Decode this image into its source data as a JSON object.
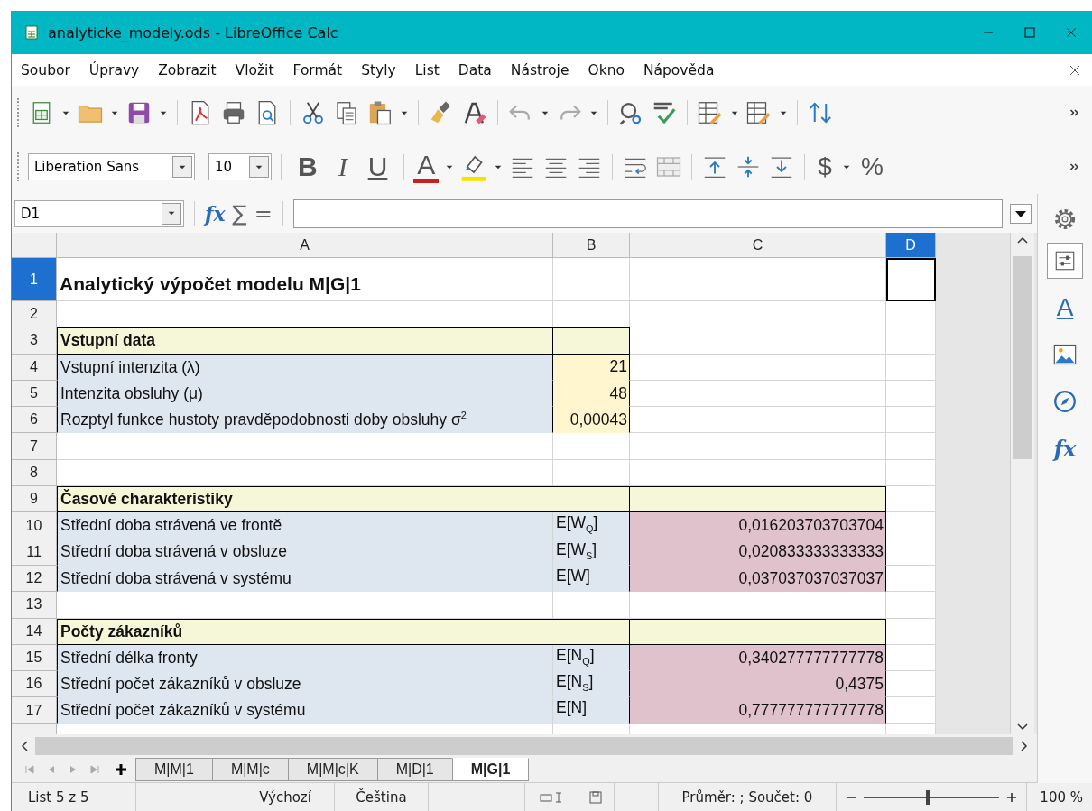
{
  "window": {
    "title": "analyticke_modely.ods - LibreOffice Calc"
  },
  "menu": [
    "Soubor",
    "Úpravy",
    "Zobrazit",
    "Vložit",
    "Formát",
    "Styly",
    "List",
    "Data",
    "Nástroje",
    "Okno",
    "Nápověda"
  ],
  "font_toolbar": {
    "font_name": "Liberation Sans",
    "font_size": "10",
    "bold": "B",
    "italic": "I",
    "underline": "U",
    "font_color": "A",
    "currency": "$",
    "percent": "%"
  },
  "formula_bar": {
    "name_box": "D1",
    "function_wizard": "fx",
    "sum": "∑",
    "equals": "="
  },
  "sidebar": [
    {
      "kind": "properties",
      "selected": true
    },
    {
      "kind": "styles",
      "label": "A",
      "selected": false
    },
    {
      "kind": "gallery",
      "selected": false
    },
    {
      "kind": "navigator",
      "selected": false
    },
    {
      "kind": "functions",
      "label": "fx",
      "selected": false
    }
  ],
  "columns": [
    {
      "label": "A",
      "selected": false
    },
    {
      "label": "B",
      "selected": false
    },
    {
      "label": "C",
      "selected": false
    },
    {
      "label": "D",
      "selected": true
    }
  ],
  "rows": [
    {
      "number": "1",
      "selected": true,
      "kind": "title",
      "a": "Analytický výpočet modelu M|G|1"
    },
    {
      "number": "2",
      "selected": false,
      "kind": "blank"
    },
    {
      "number": "3",
      "selected": false,
      "kind": "section_input",
      "a": "Vstupní data"
    },
    {
      "number": "4",
      "selected": false,
      "kind": "input",
      "a": "Vstupní intenzita (λ)",
      "b": "21"
    },
    {
      "number": "5",
      "selected": false,
      "kind": "input",
      "a": "Intenzita obsluhy (μ)",
      "b": "48"
    },
    {
      "number": "6",
      "selected": false,
      "kind": "input",
      "a": "Rozptyl funkce hustoty pravděpodobnosti doby obsluhy σ$^{2}$",
      "b": "0,00043"
    },
    {
      "number": "7",
      "selected": false,
      "kind": "blank"
    },
    {
      "number": "8",
      "selected": false,
      "kind": "blank"
    },
    {
      "number": "9",
      "selected": false,
      "kind": "section_result",
      "a": "Časové charakteristiky"
    },
    {
      "number": "10",
      "selected": false,
      "kind": "result",
      "a": "Střední doba strávená ve frontě",
      "b": "E[W$_{Q}$]",
      "c": "0,016203703703704"
    },
    {
      "number": "11",
      "selected": false,
      "kind": "result",
      "a": "Střední doba strávená v obsluze",
      "b": "E[W$_{S}$]",
      "c": "0,020833333333333"
    },
    {
      "number": "12",
      "selected": false,
      "kind": "result",
      "a": "Střední doba strávená v systému",
      "b": "E[W]",
      "c": "0,037037037037037"
    },
    {
      "number": "13",
      "selected": false,
      "kind": "blank"
    },
    {
      "number": "14",
      "selected": false,
      "kind": "section_result",
      "a": "Počty zákazníků"
    },
    {
      "number": "15",
      "selected": false,
      "kind": "result",
      "a": "Střední délka fronty",
      "b": "E[N$_{Q}$]",
      "c": "0,340277777777778"
    },
    {
      "number": "16",
      "selected": false,
      "kind": "result",
      "a": "Střední počet zákazníků v obsluze",
      "b": "E[N$_{S}$]",
      "c": "0,4375"
    },
    {
      "number": "17",
      "selected": false,
      "kind": "result",
      "a": "Střední počet zákazníků v systému",
      "b": "E[N]",
      "c": "0,777777777777778"
    }
  ],
  "sheet_tabs": [
    {
      "label": "M|M|1",
      "selected": false
    },
    {
      "label": "M|M|c",
      "selected": false
    },
    {
      "label": "M|M|c|K",
      "selected": false
    },
    {
      "label": "M|D|1",
      "selected": false
    },
    {
      "label": "M|G|1",
      "selected": true
    }
  ],
  "status_bar": {
    "sheet": "List 5 z 5",
    "page_style": "Výchozí",
    "language": "Čeština",
    "selection_summary": "Průměr: ; Součet: 0",
    "zoom": {
      "level": 0.47,
      "reading": "100 %"
    }
  }
}
